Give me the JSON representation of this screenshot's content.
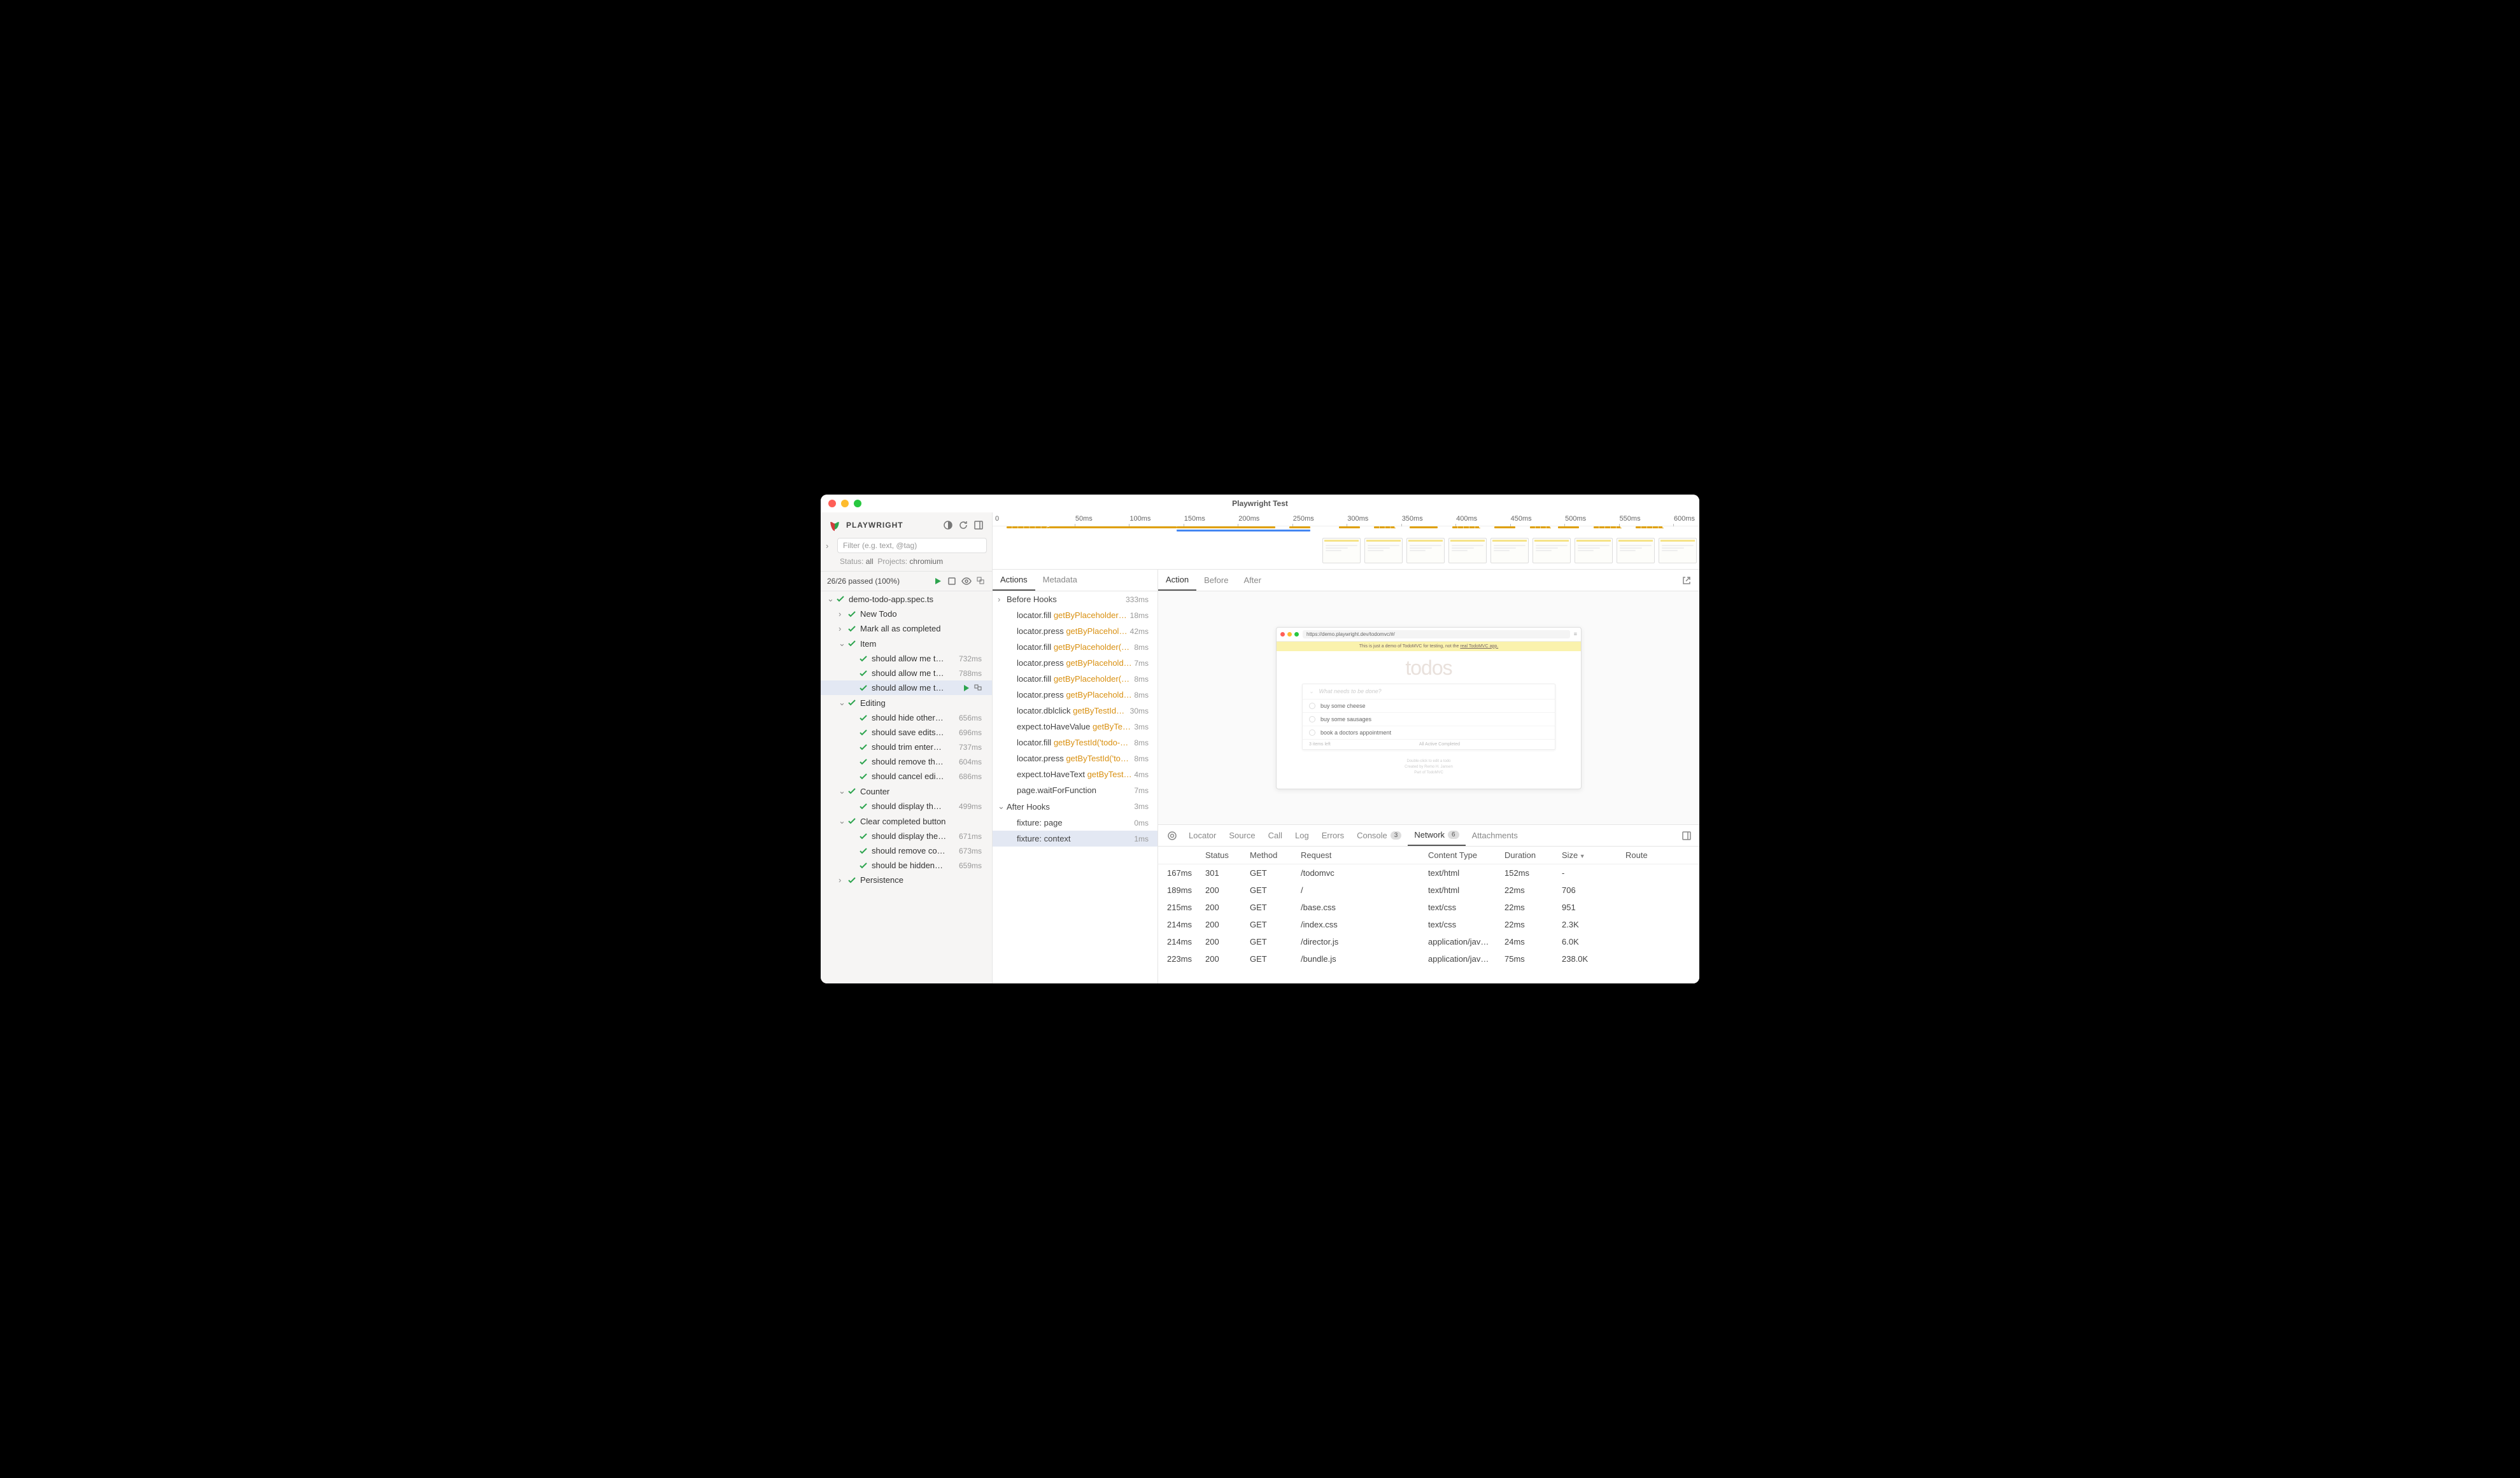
{
  "title": "Playwright Test",
  "brand": "PLAYWRIGHT",
  "filter_placeholder": "Filter (e.g. text, @tag)",
  "status_label": "Status:",
  "status_value": "all",
  "projects_label": "Projects:",
  "projects_value": "chromium",
  "pass_summary": "26/26 passed (100%)",
  "timeline": {
    "zero": "0",
    "ticks": [
      "50ms",
      "100ms",
      "150ms",
      "200ms",
      "250ms",
      "300ms",
      "350ms",
      "400ms",
      "450ms",
      "500ms",
      "550ms",
      "600ms"
    ]
  },
  "tree": [
    {
      "depth": 0,
      "chev": "down",
      "label": "demo-todo-app.spec.ts",
      "time": ""
    },
    {
      "depth": 1,
      "chev": "right",
      "label": "New Todo",
      "time": ""
    },
    {
      "depth": 1,
      "chev": "right",
      "label": "Mark all as completed",
      "time": ""
    },
    {
      "depth": 1,
      "chev": "down",
      "label": "Item",
      "time": ""
    },
    {
      "depth": 2,
      "chev": "",
      "label": "should allow me t…",
      "time": "732ms"
    },
    {
      "depth": 2,
      "chev": "",
      "label": "should allow me t…",
      "time": "788ms"
    },
    {
      "depth": 2,
      "chev": "",
      "label": "should allow me t…",
      "time": "",
      "selected": true
    },
    {
      "depth": 1,
      "chev": "down",
      "label": "Editing",
      "time": ""
    },
    {
      "depth": 2,
      "chev": "",
      "label": "should hide other…",
      "time": "656ms"
    },
    {
      "depth": 2,
      "chev": "",
      "label": "should save edits…",
      "time": "696ms"
    },
    {
      "depth": 2,
      "chev": "",
      "label": "should trim enter…",
      "time": "737ms"
    },
    {
      "depth": 2,
      "chev": "",
      "label": "should remove th…",
      "time": "604ms"
    },
    {
      "depth": 2,
      "chev": "",
      "label": "should cancel edi…",
      "time": "686ms"
    },
    {
      "depth": 1,
      "chev": "down",
      "label": "Counter",
      "time": ""
    },
    {
      "depth": 2,
      "chev": "",
      "label": "should display th…",
      "time": "499ms"
    },
    {
      "depth": 1,
      "chev": "down",
      "label": "Clear completed button",
      "time": ""
    },
    {
      "depth": 2,
      "chev": "",
      "label": "should display the…",
      "time": "671ms"
    },
    {
      "depth": 2,
      "chev": "",
      "label": "should remove co…",
      "time": "673ms"
    },
    {
      "depth": 2,
      "chev": "",
      "label": "should be hidden…",
      "time": "659ms"
    },
    {
      "depth": 1,
      "chev": "right",
      "label": "Persistence",
      "time": ""
    }
  ],
  "actions_tabs": [
    "Actions",
    "Metadata"
  ],
  "actions": [
    {
      "chev": "right",
      "indent": 0,
      "text": "Before Hooks",
      "hl": "",
      "time": "333ms"
    },
    {
      "chev": "",
      "indent": 1,
      "text": "locator.fill ",
      "hl": "getByPlaceholder…",
      "time": "18ms"
    },
    {
      "chev": "",
      "indent": 1,
      "text": "locator.press ",
      "hl": "getByPlacehol…",
      "time": "42ms"
    },
    {
      "chev": "",
      "indent": 1,
      "text": "locator.fill ",
      "hl": "getByPlaceholder(…",
      "time": "8ms"
    },
    {
      "chev": "",
      "indent": 1,
      "text": "locator.press ",
      "hl": "getByPlacehold…",
      "time": "7ms"
    },
    {
      "chev": "",
      "indent": 1,
      "text": "locator.fill ",
      "hl": "getByPlaceholder(…",
      "time": "8ms"
    },
    {
      "chev": "",
      "indent": 1,
      "text": "locator.press ",
      "hl": "getByPlacehold…",
      "time": "8ms"
    },
    {
      "chev": "",
      "indent": 1,
      "text": "locator.dblclick ",
      "hl": "getByTestId…",
      "time": "30ms"
    },
    {
      "chev": "",
      "indent": 1,
      "text": "expect.toHaveValue ",
      "hl": "getByTe…",
      "time": "3ms"
    },
    {
      "chev": "",
      "indent": 1,
      "text": "locator.fill ",
      "hl": "getByTestId('todo-…",
      "time": "8ms"
    },
    {
      "chev": "",
      "indent": 1,
      "text": "locator.press ",
      "hl": "getByTestId('to…",
      "time": "8ms"
    },
    {
      "chev": "",
      "indent": 1,
      "text": "expect.toHaveText ",
      "hl": "getByTest…",
      "time": "4ms"
    },
    {
      "chev": "",
      "indent": 1,
      "text": "page.waitForFunction",
      "hl": "",
      "time": "7ms"
    },
    {
      "chev": "down",
      "indent": 0,
      "text": "After Hooks",
      "hl": "",
      "time": "3ms"
    },
    {
      "chev": "",
      "indent": 1,
      "text": "fixture: page",
      "hl": "",
      "time": "0ms"
    },
    {
      "chev": "",
      "indent": 1,
      "text": "fixture: context",
      "hl": "",
      "time": "1ms",
      "selected": true
    }
  ],
  "preview_tabs": [
    "Action",
    "Before",
    "After"
  ],
  "browser": {
    "url": "https://demo.playwright.dev/todomvc/#/",
    "banner_pre": "This is just a demo of TodoMVC for testing, not the ",
    "banner_link": "real TodoMVC app.",
    "title": "todos",
    "placeholder": "What needs to be done?",
    "items": [
      "buy some cheese",
      "buy some sausages",
      "book a doctors appointment"
    ],
    "footer_left": "3 items left",
    "footer_mid": "All   Active   Completed",
    "credit1": "Double-click to edit a todo",
    "credit2": "Created by Remo H. Jansen",
    "credit3": "Part of TodoMVC"
  },
  "bottom_tabs": [
    {
      "label": "Locator"
    },
    {
      "label": "Source"
    },
    {
      "label": "Call"
    },
    {
      "label": "Log"
    },
    {
      "label": "Errors"
    },
    {
      "label": "Console",
      "badge": "3"
    },
    {
      "label": "Network",
      "badge": "6",
      "active": true
    },
    {
      "label": "Attachments"
    }
  ],
  "net_headers": [
    "",
    "Status",
    "Method",
    "Request",
    "Content Type",
    "Duration",
    "Size",
    "Route"
  ],
  "net_rows": [
    {
      "start": "167ms",
      "status": "301",
      "method": "GET",
      "request": "/todomvc",
      "ctype": "text/html",
      "dur": "152ms",
      "size": "-",
      "route": ""
    },
    {
      "start": "189ms",
      "status": "200",
      "method": "GET",
      "request": "/",
      "ctype": "text/html",
      "dur": "22ms",
      "size": "706",
      "route": ""
    },
    {
      "start": "215ms",
      "status": "200",
      "method": "GET",
      "request": "/base.css",
      "ctype": "text/css",
      "dur": "22ms",
      "size": "951",
      "route": ""
    },
    {
      "start": "214ms",
      "status": "200",
      "method": "GET",
      "request": "/index.css",
      "ctype": "text/css",
      "dur": "22ms",
      "size": "2.3K",
      "route": ""
    },
    {
      "start": "214ms",
      "status": "200",
      "method": "GET",
      "request": "/director.js",
      "ctype": "application/jav…",
      "dur": "24ms",
      "size": "6.0K",
      "route": ""
    },
    {
      "start": "223ms",
      "status": "200",
      "method": "GET",
      "request": "/bundle.js",
      "ctype": "application/jav…",
      "dur": "75ms",
      "size": "238.0K",
      "route": ""
    }
  ]
}
